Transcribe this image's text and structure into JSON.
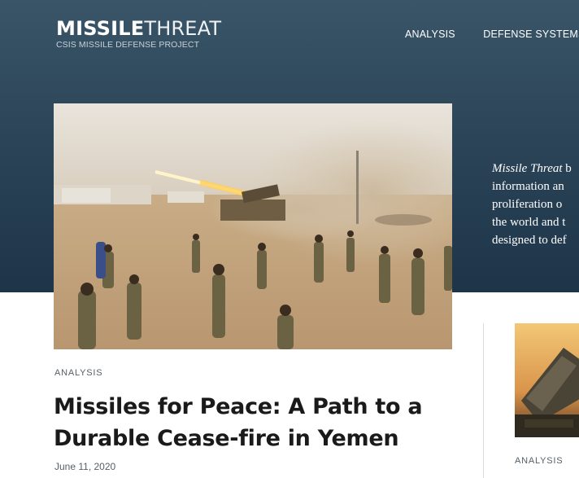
{
  "header": {
    "logo_bold": "MISSILE",
    "logo_light": "THREAT",
    "logo_sub": "CSIS MISSILE DEFENSE PROJECT"
  },
  "nav": {
    "items": [
      {
        "label": "ANALYSIS"
      },
      {
        "label": "DEFENSE SYSTEMS"
      }
    ]
  },
  "intro": {
    "brand": "Missile Threat",
    "line1_rest": " b",
    "line2": "information an",
    "line3": "proliferation o",
    "line4": "the world and t",
    "line5": "designed to def"
  },
  "featured": {
    "category": "ANALYSIS",
    "headline": "Missiles for Peace: A Path to a Durable Cease-fire in Yemen",
    "date": "June 11, 2020",
    "image_icon": "photo-rocket-launch"
  },
  "sidebar_article": {
    "category": "ANALYSIS",
    "image_icon": "photo-missile-launcher"
  },
  "colors": {
    "hero_bg": "#2c4559",
    "text_dark": "#1a1a1a",
    "meta_gray": "#555f66"
  }
}
